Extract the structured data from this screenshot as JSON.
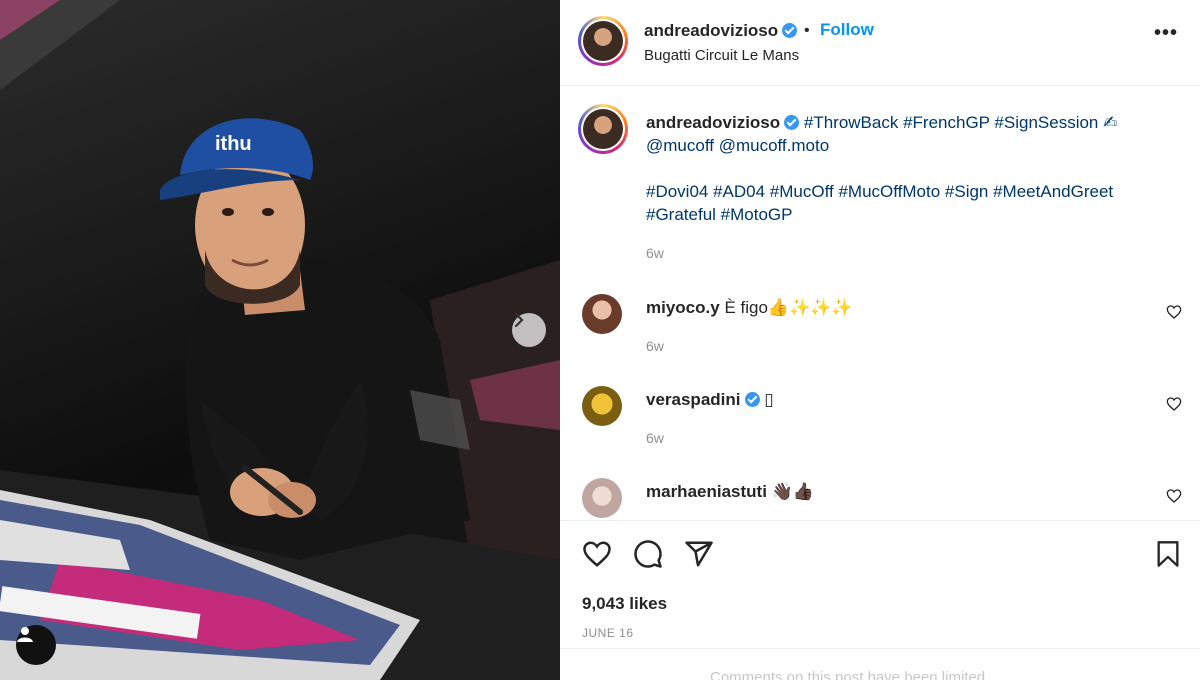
{
  "post": {
    "username": "andreadovizioso",
    "follow_label": "Follow",
    "dot": "•",
    "location": "Bugatti Circuit Le Mans",
    "more": "•••",
    "caption_line1": "#ThrowBack #FrenchGP #SignSession ✍",
    "caption_line2": "@mucoff @mucoff.moto",
    "caption_line3": "#Dovi04 #AD04 #MucOff #MucOffMoto #Sign #MeetAndGreet",
    "caption_line4": "#Grateful #MotoGP",
    "caption_time": "6w"
  },
  "comments": [
    {
      "username": "miyoco.y",
      "text": "È figo👍✨✨✨",
      "time": "6w",
      "avatar_color": "#b97a5d"
    },
    {
      "username": "veraspadini",
      "verified": true,
      "text": "▯",
      "time": "6w",
      "avatar_color": "#d2a21c"
    },
    {
      "username": "marhaeniastuti",
      "text": "👋🏿👍🏿",
      "time": "",
      "avatar_color": "#e8d7d3"
    }
  ],
  "footer": {
    "likes": "9,043 likes",
    "date": "JUNE 16",
    "comment_placeholder": "Comments on this post have been limited."
  },
  "colors": {
    "accent": "#0095f6",
    "hashtag": "#00376b",
    "muted": "#8e8e8e",
    "verified": "#3897f0"
  },
  "icons": [
    "chevron-right-icon",
    "person-tag-icon",
    "heart-icon",
    "comment-icon",
    "share-icon",
    "bookmark-icon",
    "verified-icon",
    "more-icon"
  ]
}
